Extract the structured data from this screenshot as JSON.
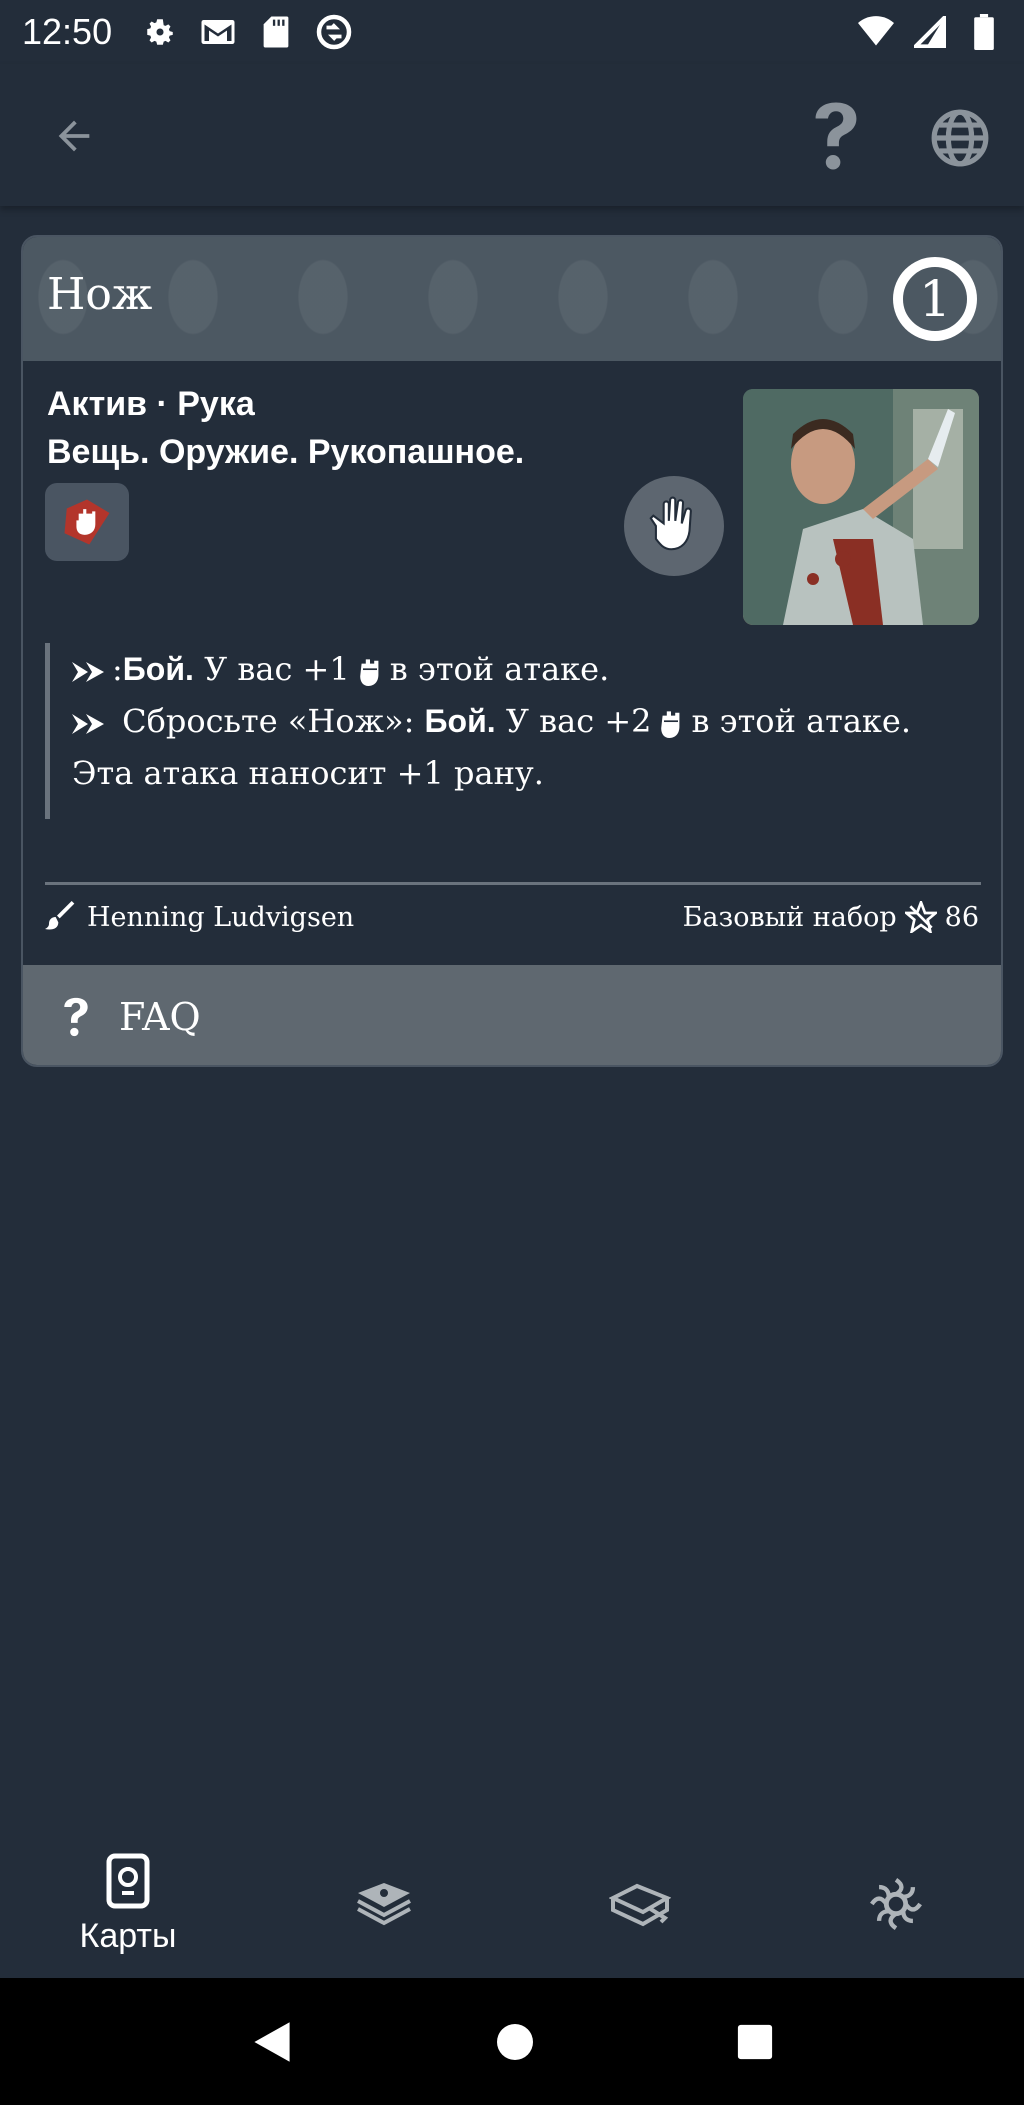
{
  "status_bar": {
    "time": "12:50",
    "icons": [
      "settings-icon",
      "gmail-icon",
      "sd-card-icon",
      "sync-icon",
      "wifi-icon",
      "signal-icon",
      "battery-icon"
    ]
  },
  "app_bar": {
    "icons": [
      "back-arrow-icon",
      "help-icon",
      "globe-icon"
    ]
  },
  "card": {
    "title": "Нож",
    "cost": "1",
    "type_line": "Актив · Рука",
    "traits": "Вещь. Оружие. Рукопашное.",
    "class_icon": "fist-icon",
    "slot_icon": "hand-icon",
    "text": {
      "line1_sep": ":",
      "line1_bold": "Бой.",
      "line1_pre": " У вас +1",
      "line1_post": "в этой атаке.",
      "line2_pre": " Сбросьте «Нож»: ",
      "line2_bold": "Бой.",
      "line2_mid": " У вас +2",
      "line2_post": "в этой атаке.",
      "line3": "Эта атака наносит +1 рану."
    },
    "artist": "Henning Ludvigsen",
    "pack": "Базовый набор",
    "number": "86",
    "faq_label": "FAQ"
  },
  "bottom_nav": {
    "items": [
      {
        "label": "Карты",
        "icon": "cards-icon",
        "active": true
      },
      {
        "label": "",
        "icon": "decks-icon",
        "active": false
      },
      {
        "label": "",
        "icon": "rules-book-icon",
        "active": false
      },
      {
        "label": "",
        "icon": "portal-icon",
        "active": false
      }
    ]
  },
  "colors": {
    "background": "#232d3a",
    "header": "#4c5862",
    "faq_bar": "#5f6870",
    "guardian_red": "#b3352b"
  }
}
